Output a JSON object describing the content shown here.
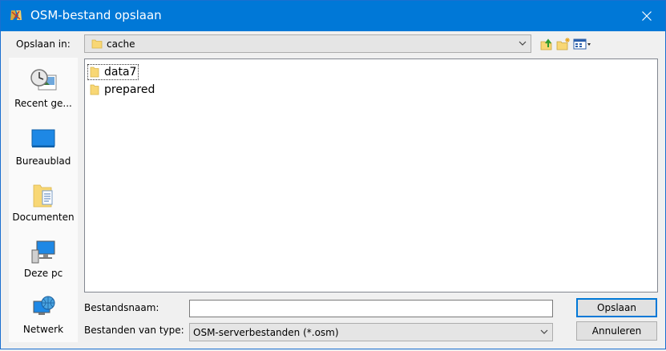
{
  "window": {
    "title": "OSM-bestand opslaan"
  },
  "lookin": {
    "label": "Opslaan in:",
    "value": "cache"
  },
  "places": [
    {
      "label": "Recent ge..."
    },
    {
      "label": "Bureaublad"
    },
    {
      "label": "Documenten"
    },
    {
      "label": "Deze pc"
    },
    {
      "label": "Netwerk"
    }
  ],
  "files": [
    {
      "name": "data7"
    },
    {
      "name": "prepared"
    }
  ],
  "filename": {
    "label": "Bestandsnaam:",
    "value": ""
  },
  "filetype": {
    "label": "Bestanden van type:",
    "value": "OSM-serverbestanden (*.osm)"
  },
  "buttons": {
    "save": "Opslaan",
    "cancel": "Annuleren"
  },
  "colors": {
    "titlebar": "#0078d7",
    "folder": "#f8d775"
  }
}
